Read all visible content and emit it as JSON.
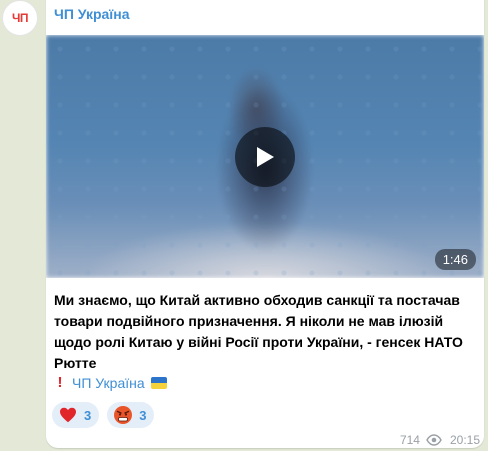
{
  "channel": {
    "avatar_text": "ЧП",
    "name": "ЧП Україна"
  },
  "video": {
    "duration": "1:46"
  },
  "message": {
    "text": "Ми знаємо, що Китай активно обходив санкції та постачав товари подвійного призначення. Я ніколи не мав ілюзій щодо ролі Китаю у війні Росії проти України, - генсек НАТО Рютте"
  },
  "signature": {
    "icon": "exclamation-icon",
    "link_text": "ЧП Україна",
    "flag": "ukraine-flag-icon"
  },
  "reactions": [
    {
      "emoji": "heart-icon",
      "count": "3"
    },
    {
      "emoji": "angry-face-icon",
      "count": "3"
    }
  ],
  "meta": {
    "views": "714",
    "time": "20:15"
  },
  "colors": {
    "link": "#3f8fd4",
    "background": "#e3e9d6",
    "reaction_bg": "#e4eef8"
  }
}
